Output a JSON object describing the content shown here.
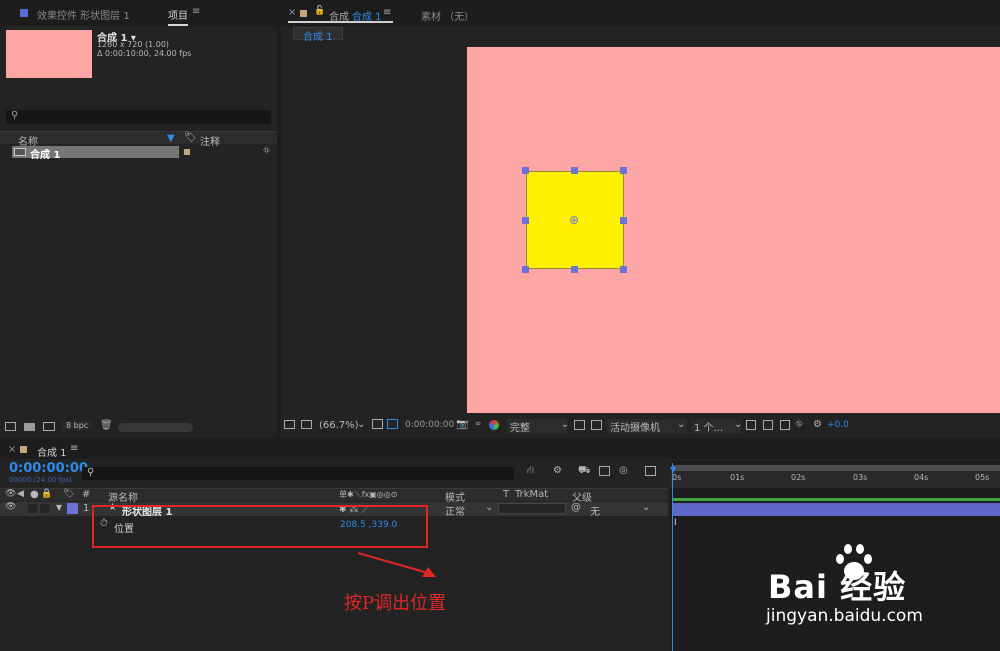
{
  "project_panel": {
    "tab_effects": "效果控件 形状图层 1",
    "tab_project": "项目",
    "comp_name": "合成 1 ▾",
    "comp_size": "1280 x 720 (1.00)",
    "comp_duration": "Δ 0:00:10:00, 24.00 fps",
    "col_name": "名称",
    "col_comment": "注释",
    "item_name": "合成 1",
    "bpc": "8 bpc",
    "thumb_color": "#fea6a6"
  },
  "comp_panel": {
    "tab_comp_prefix": "合成",
    "tab_comp_name": "合成 1",
    "tab_footage": "素材 （无）",
    "breadcrumb": "合成 1",
    "bg_color": "#fea6a6",
    "shape_color": "#fff000",
    "zoom": "(66.7%)",
    "timecode": "0:00:00:00",
    "quality": "完整",
    "camera": "活动摄像机",
    "views": "1 个...",
    "exposure": "+0.0"
  },
  "timeline": {
    "tab": "合成 1",
    "timecode": "0:00:00:00",
    "frames": "00000 (24.00 fps)",
    "col_source": "源名称",
    "col_switches": "单✱＼fx▣◎◎⊙",
    "col_mode": "模式",
    "col_t": "T",
    "col_trkmat": "TrkMat",
    "col_parent": "父级",
    "layer_num": "1",
    "layer_name": "形状图层 1",
    "layer_mode": "正常",
    "layer_parent": "无",
    "prop_name": "位置",
    "prop_value": "208.5 ,339.0",
    "ruler": [
      "0s",
      "01s",
      "02s",
      "03s",
      "04s",
      "05s"
    ]
  },
  "annotation": {
    "text": "按P调出位置"
  },
  "watermark": {
    "brand": "Bai 经验",
    "url": "jingyan.baidu.com"
  }
}
